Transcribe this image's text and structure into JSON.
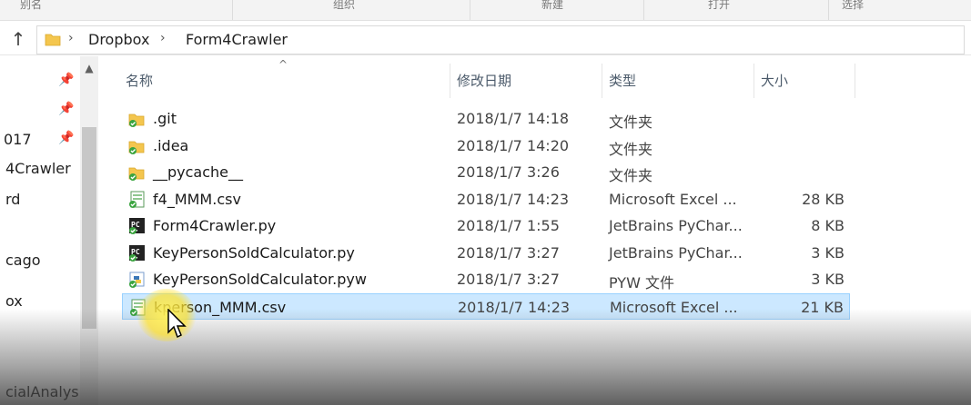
{
  "ribbon": {
    "items": [
      "别名",
      "组织",
      "新建",
      "打开",
      "选择"
    ]
  },
  "address": {
    "crumbs": [
      "Dropbox",
      "Form4Crawler"
    ]
  },
  "nav": {
    "items": [
      "017",
      "4Crawler",
      "rd",
      "cago",
      "ox",
      "cialAnalys"
    ]
  },
  "columns": {
    "name": "名称",
    "date": "修改日期",
    "type": "类型",
    "size": "大小"
  },
  "files": [
    {
      "name": ".git",
      "date": "2018/1/7 14:18",
      "type": "文件夹",
      "size": "",
      "icon": "folder-icon"
    },
    {
      "name": ".idea",
      "date": "2018/1/7 14:20",
      "type": "文件夹",
      "size": "",
      "icon": "folder-icon"
    },
    {
      "name": "__pycache__",
      "date": "2018/1/7 3:26",
      "type": "文件夹",
      "size": "",
      "icon": "folder-icon"
    },
    {
      "name": "f4_MMM.csv",
      "date": "2018/1/7 14:23",
      "type": "Microsoft Excel ...",
      "size": "28 KB",
      "icon": "excel-csv-icon"
    },
    {
      "name": "Form4Crawler.py",
      "date": "2018/1/7 1:55",
      "type": "JetBrains PyChar...",
      "size": "8 KB",
      "icon": "pycharm-icon"
    },
    {
      "name": "KeyPersonSoldCalculator.py",
      "date": "2018/1/7 3:27",
      "type": "JetBrains PyChar...",
      "size": "3 KB",
      "icon": "pycharm-icon"
    },
    {
      "name": "KeyPersonSoldCalculator.pyw",
      "date": "2018/1/7 3:27",
      "type": "PYW 文件",
      "size": "3 KB",
      "icon": "python-file-icon"
    },
    {
      "name": "kperson_MMM.csv",
      "date": "2018/1/7 14:23",
      "type": "Microsoft Excel ...",
      "size": "21 KB",
      "icon": "excel-csv-icon",
      "selected": true
    }
  ],
  "colors": {
    "selection_bg": "#cce8ff",
    "selection_border": "#99d1ff",
    "folder": "#f4c64e",
    "sync_green": "#3aa43f"
  }
}
